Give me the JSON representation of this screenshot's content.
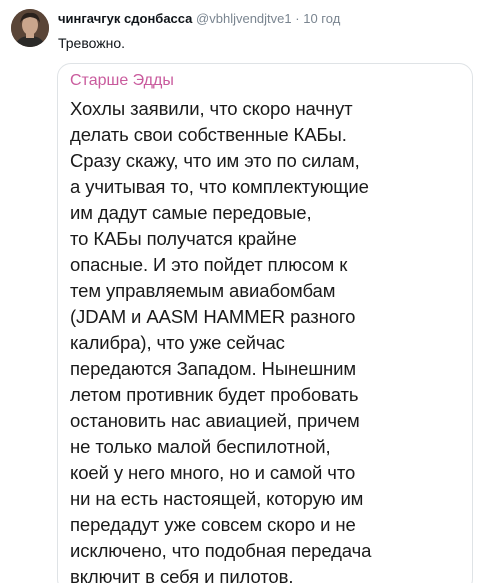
{
  "tweet": {
    "author": {
      "display_name": "чингачгук сдонбасса",
      "handle": "@vbhljvendjtve1",
      "separator": "·",
      "time": "10 год",
      "avatar_icon": "user-avatar-photo"
    },
    "text": "Тревожно."
  },
  "quoted_post": {
    "author": "Старше Эдды",
    "author_color": "#c95b9d",
    "lines": [
      "Хохлы заявили, что скоро начнут",
      "делать свои собственные КАБы.",
      "Сразу скажу, что им это по силам,",
      "а учитывая то, что комплектующие",
      "им дадут самые передовые,",
      "то КАБы получатся крайне",
      "опасные. И это пойдет плюсом к",
      "тем управляемым авиабомбам",
      "(JDAM и AASM HAMMER разного",
      "калибра), что уже сейчас",
      "передаются Западом. Нынешним",
      "летом противник будет пробовать",
      "остановить нас авиацией, причем",
      "не только малой беспилотной,",
      "коей у него много, но и самой что",
      "ни на есть настоящей, которую им",
      "передадут уже совсем скоро и не",
      "исключено, что подобная передача",
      "включит в себя и пилотов."
    ]
  }
}
